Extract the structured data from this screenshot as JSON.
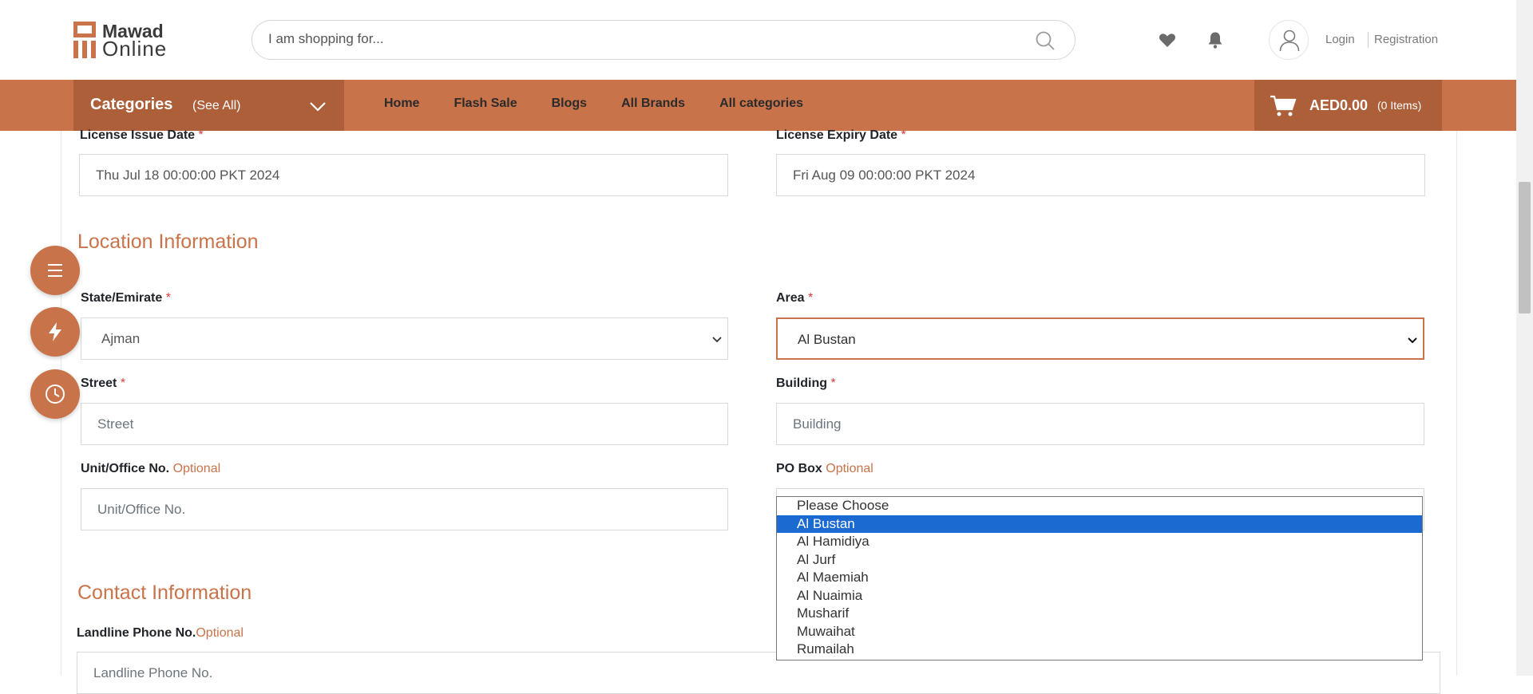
{
  "header": {
    "logo_line1": "Mawad",
    "logo_line2": "Online",
    "search_placeholder": "I am shopping for...",
    "login_label": "Login",
    "registration_label": "Registration"
  },
  "nav": {
    "categories_label": "Categories",
    "see_all_label": "(See All)",
    "links": [
      "Home",
      "Flash Sale",
      "Blogs",
      "All Brands",
      "All categories"
    ],
    "cart_amount": "AED0.00",
    "cart_items": "(0 Items)"
  },
  "license": {
    "issue_label": "License Issue Date",
    "issue_value": "Thu Jul 18 00:00:00 PKT 2024",
    "expiry_label": "License Expiry Date",
    "expiry_value": "Fri Aug 09 00:00:00 PKT 2024"
  },
  "location": {
    "section_title": "Location Information",
    "state_label": "State/Emirate",
    "state_value": "Ajman",
    "area_label": "Area",
    "area_value": "Al Bustan",
    "street_label": "Street",
    "street_placeholder": "Street",
    "building_label": "Building",
    "building_placeholder": "Building",
    "unit_label": "Unit/Office No.",
    "unit_placeholder": "Unit/Office No.",
    "pobox_label": "PO Box",
    "optional_text": "Optional",
    "required_mark": "*"
  },
  "contact": {
    "section_title": "Contact Information",
    "landline_label": "Landline Phone No.",
    "landline_placeholder": "Landline Phone No."
  },
  "area_dropdown": {
    "options": [
      "Please Choose",
      "Al Bustan",
      "Al Hamidiya",
      "Al Jurf",
      "Al Maemiah",
      "Al Nuaimia",
      "Musharif",
      "Muwaihat",
      "Rumailah"
    ],
    "selected_index": 1
  },
  "colors": {
    "brand": "#c9734a",
    "brand_dark": "#ad5f3a",
    "selected_option": "#1a6ad2"
  }
}
